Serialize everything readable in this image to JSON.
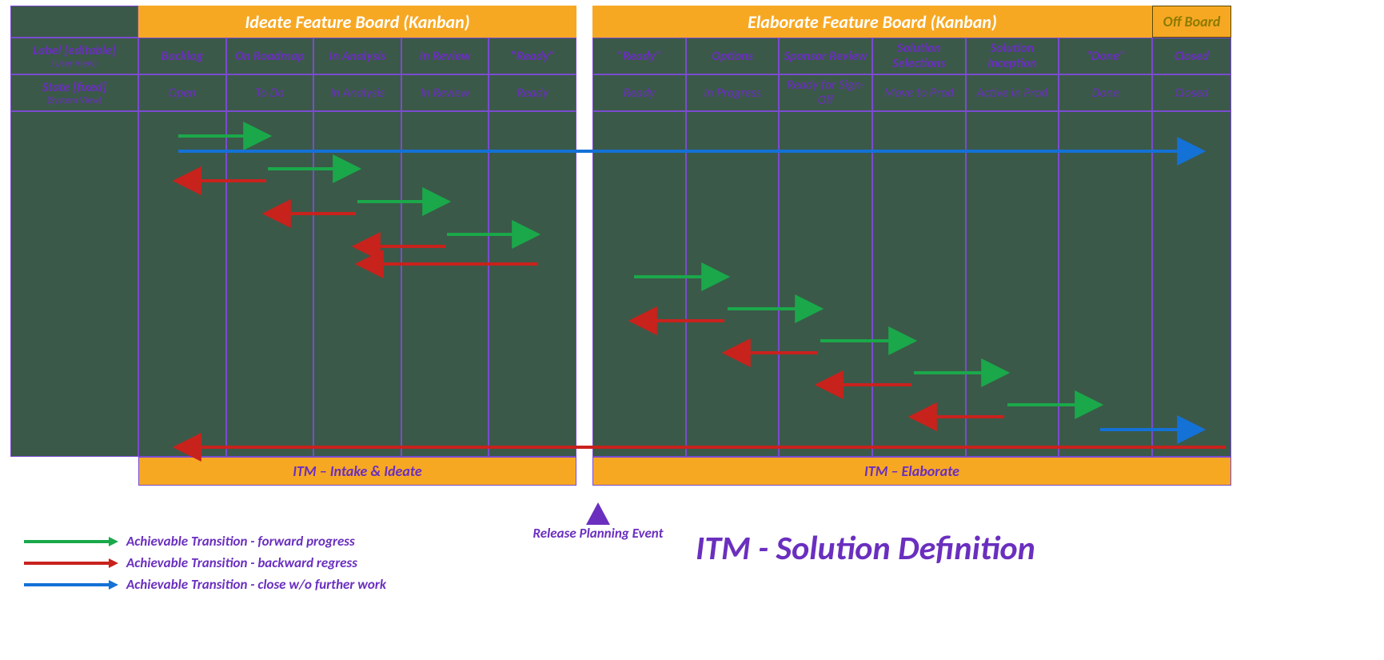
{
  "banners": {
    "ideate": "Ideate Feature Board (Kanban)",
    "elaborate": "Elaborate Feature Board (Kanban)",
    "offboard": "Off Board"
  },
  "rowheaders": {
    "label_main": "Label [editable]",
    "label_sub": "(User View)",
    "state_main": "State [fixed]",
    "state_sub": "(System View)"
  },
  "columns": {
    "ideate_labels": [
      "Backlog",
      "On Roadmap",
      "In Analysis",
      "In Review",
      "\"Ready\""
    ],
    "ideate_states": [
      "Open",
      "To Do",
      "In Analysis",
      "In Review",
      "Ready"
    ],
    "elaborate_labels": [
      "\"Ready\"",
      "Options",
      "Sponsor Review",
      "Solution Selections",
      "Solution Inception",
      "\"Done\""
    ],
    "elaborate_states": [
      "Ready",
      "In Progress",
      "Ready for Sign-Off",
      "Move to Prod",
      "Active in Prod",
      "Done"
    ],
    "off_label": "Closed",
    "off_state": "Closed"
  },
  "footers": {
    "ideate": "ITM – Intake & Ideate",
    "elaborate": "ITM – Elaborate"
  },
  "legend": {
    "forward": "Achievable Transition - forward progress",
    "backward": "Achievable Transition - backward regress",
    "close": "Achievable Transition - close w/o further work"
  },
  "release_event": "Release Planning Event",
  "title": "ITM - Solution Definition",
  "colors": {
    "green": "#1aa84a",
    "red": "#c8221d",
    "blue": "#1471d6"
  }
}
